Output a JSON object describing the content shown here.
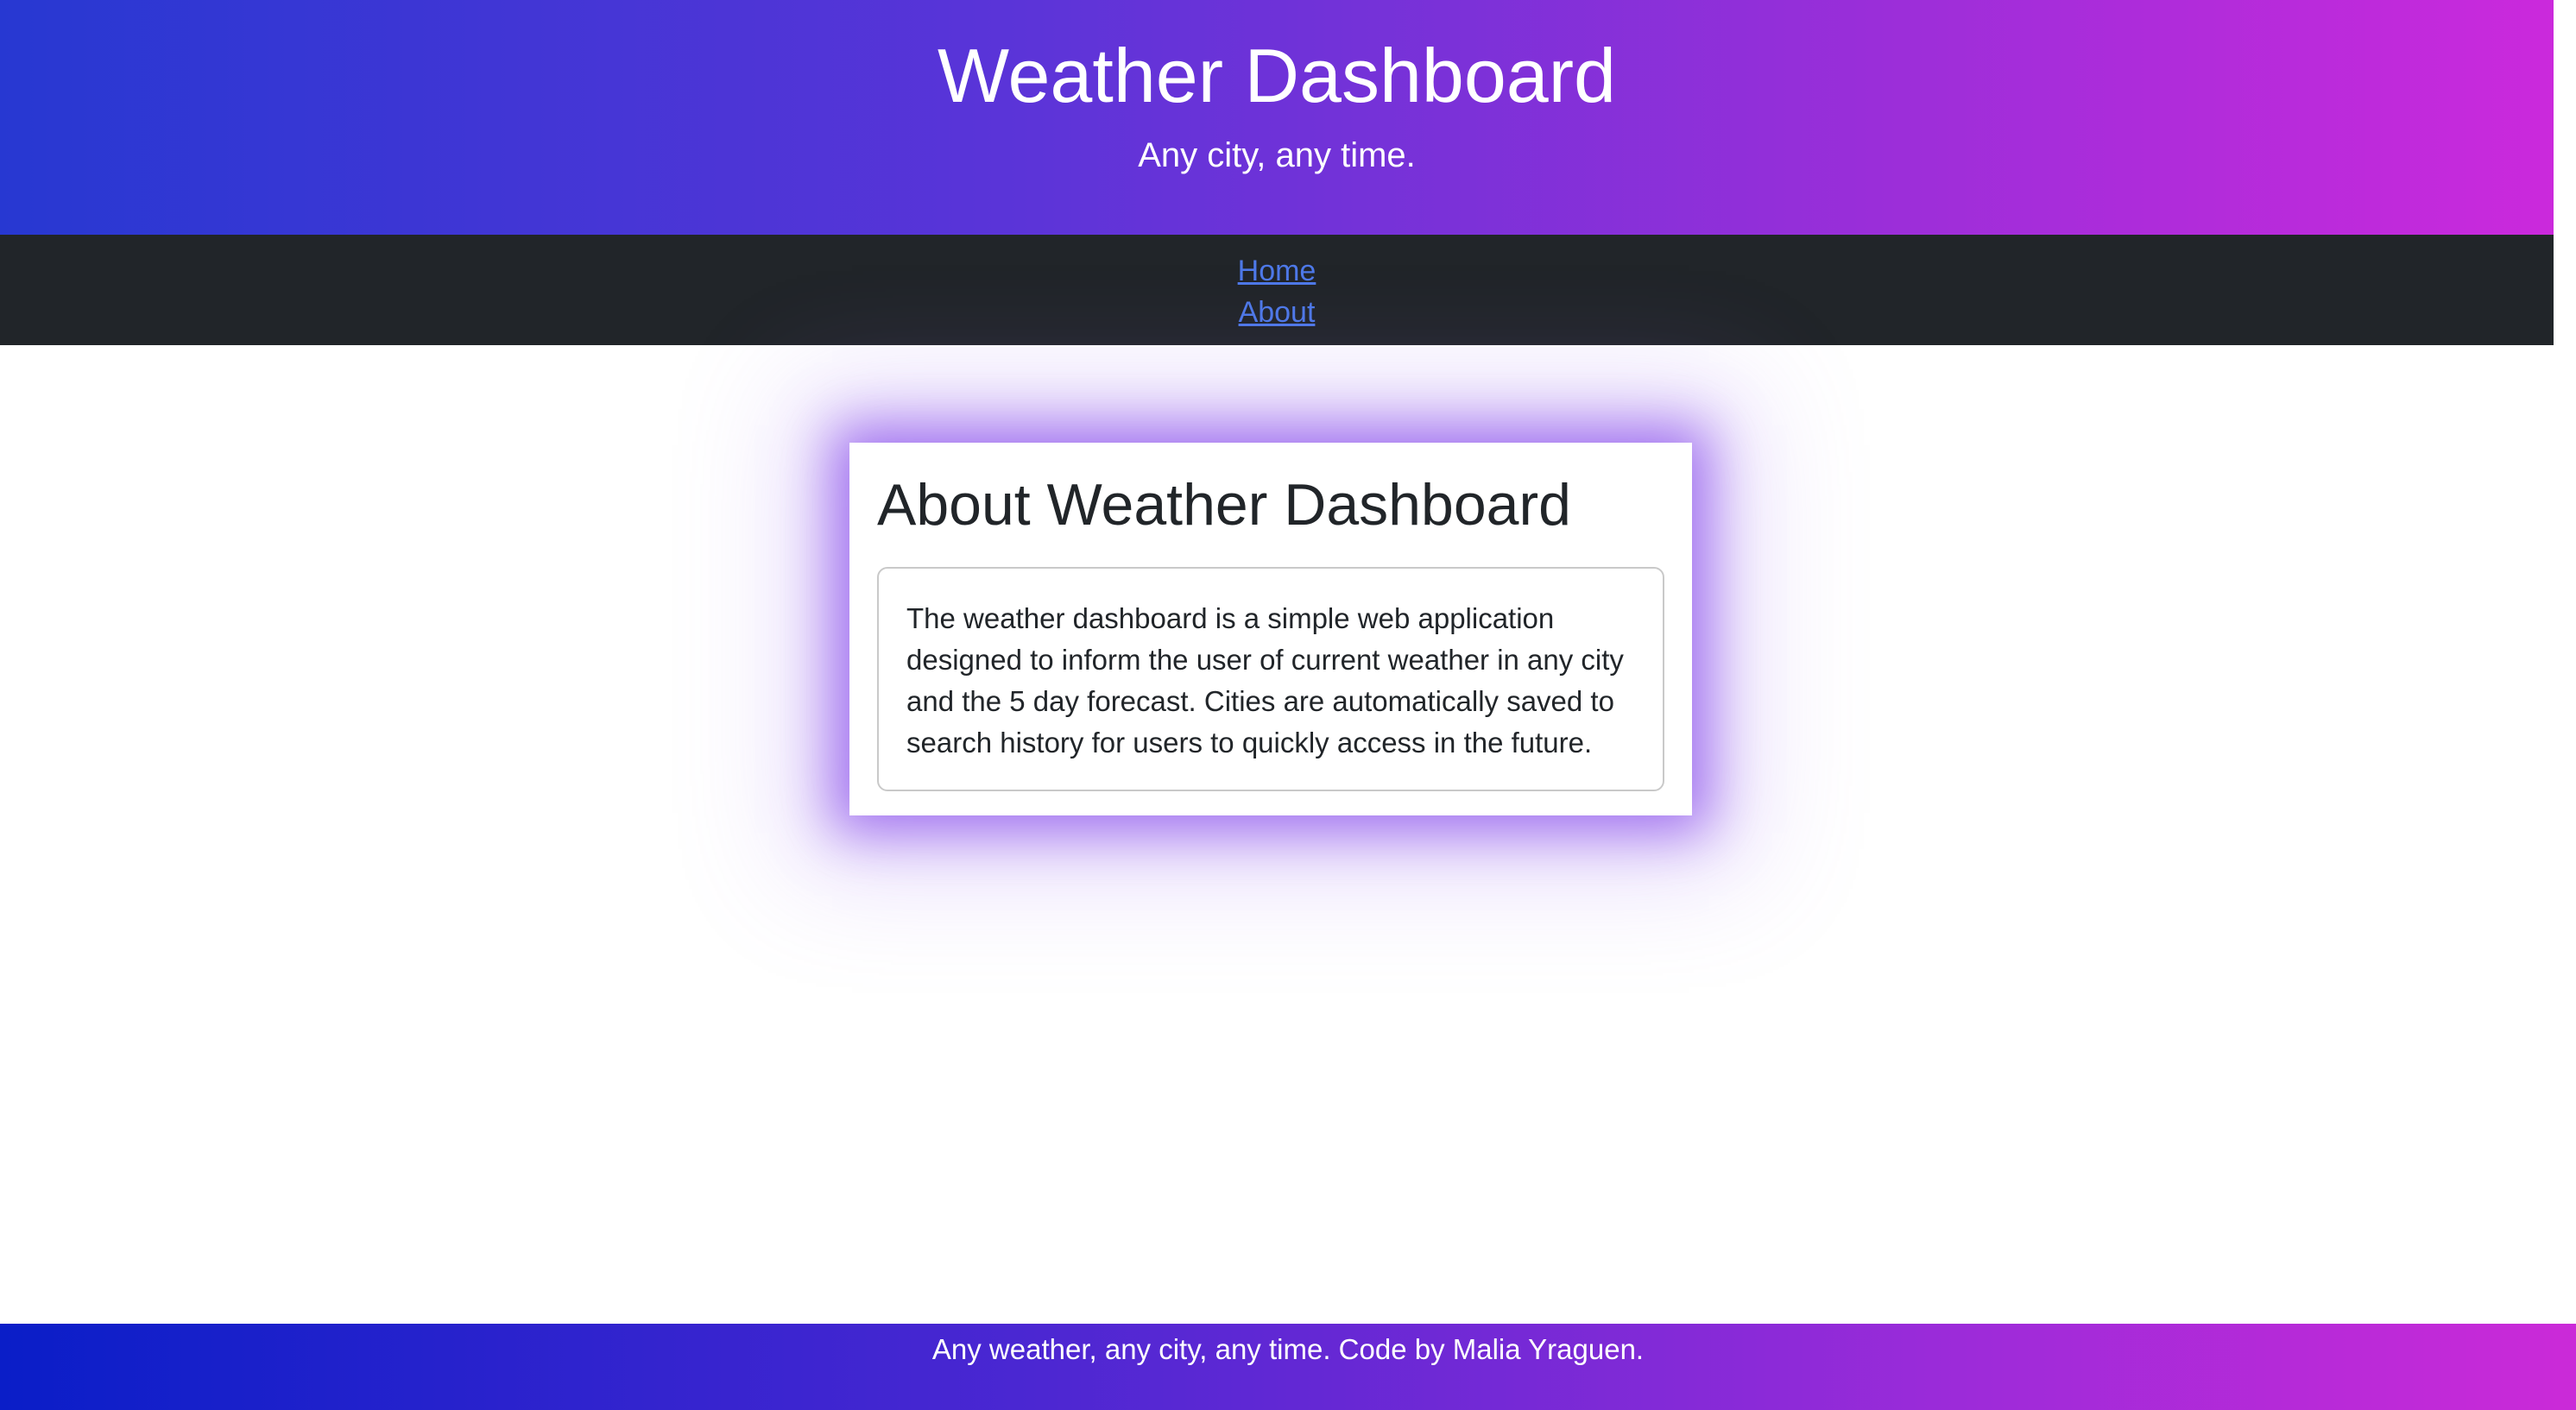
{
  "header": {
    "title": "Weather Dashboard",
    "subtitle": "Any city, any time."
  },
  "nav": {
    "items": [
      {
        "label": "Home"
      },
      {
        "label": "About"
      }
    ]
  },
  "main": {
    "card_title": "About Weather Dashboard",
    "card_text": "The weather dashboard is a simple web application designed to inform the user of current weather in any city and the 5 day forecast. Cities are automatically saved to search history for users to quickly access in the future."
  },
  "footer": {
    "text": "Any weather, any city, any time. Code by Malia Yraguen."
  },
  "colors": {
    "nav_background": "#212529",
    "link": "#4e79e8",
    "gradient_start": "#2738d2",
    "gradient_end": "#cb29dc",
    "card_glow": "#884ceb"
  }
}
